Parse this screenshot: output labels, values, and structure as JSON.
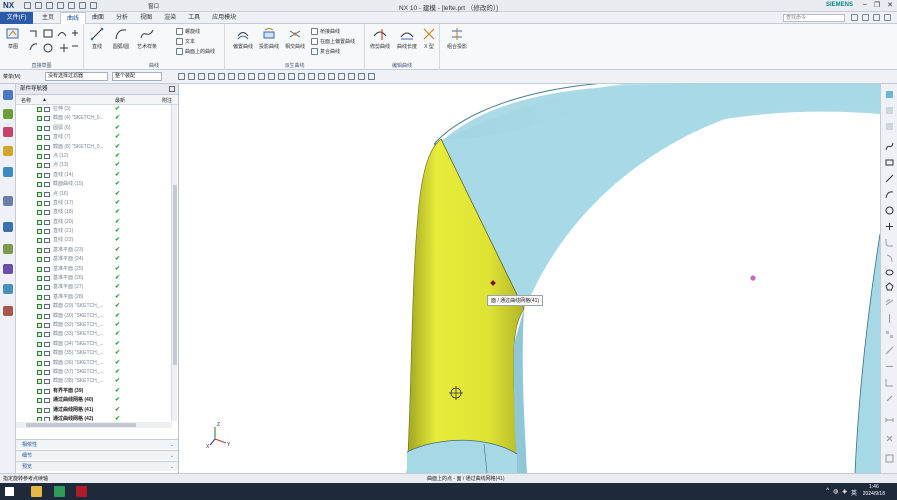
{
  "window": {
    "logo": "NX",
    "title": "NX 10 - 建模 - [lefte.prt （修改的）]",
    "brand": "SIEMENS",
    "window_menu": "窗口"
  },
  "menu": {
    "file": "文件(F)",
    "tabs": [
      "主页",
      "曲线",
      "曲面",
      "分析",
      "视图",
      "渲染",
      "工具",
      "应用模块"
    ],
    "active_tab": "曲线",
    "search_placeholder": "查找命令"
  },
  "ribbon": {
    "sketch": "草图",
    "direct_sketch_group": "直接草图",
    "line": "直线",
    "arc_circle": "圆弧/圆",
    "art_spline": "艺术样条",
    "small_curve": [
      "螺旋线",
      "文本",
      "曲面上的曲线"
    ],
    "curve_group": "曲线",
    "project_curve": "偏置曲线",
    "offset_curve": "投影曲线",
    "intersect_curve": "相交曲线",
    "derived_small": [
      "桥接曲线",
      "在面上偏置曲线",
      "复合曲线"
    ],
    "derived_group": "派生曲线",
    "trim_curve": "修剪曲线",
    "curve_length": "曲线长度",
    "x_type": "X 型",
    "combine_proj": "组合投影",
    "edit_group": "编辑曲线"
  },
  "selbar": {
    "menu": "菜单(M)",
    "filter": "没有选择过滤器",
    "assembly": "整个装配"
  },
  "navigator": {
    "title": "部件导航器",
    "col_name": "名称",
    "col_latest": "最新",
    "col_note": "附注",
    "rows": [
      {
        "label": "拉伸 (3)",
        "dark": false
      },
      {
        "label": "截面 (4) \"SKETCH_0...",
        "dark": false
      },
      {
        "label": "圆弧 (6)",
        "dark": false
      },
      {
        "label": "直线 (7)",
        "dark": false
      },
      {
        "label": "截面 (8) \"SKETCH_0...",
        "dark": false
      },
      {
        "label": "点 (12)",
        "dark": false
      },
      {
        "label": "点 (13)",
        "dark": false
      },
      {
        "label": "直线 (14)",
        "dark": false
      },
      {
        "label": "截面曲线 (15)",
        "dark": false
      },
      {
        "label": "点 (16)",
        "dark": false
      },
      {
        "label": "直线 (17)",
        "dark": false
      },
      {
        "label": "直线 (18)",
        "dark": false
      },
      {
        "label": "直线 (20)",
        "dark": false
      },
      {
        "label": "直线 (21)",
        "dark": false
      },
      {
        "label": "直线 (22)",
        "dark": false
      },
      {
        "label": "基准平面 (23)",
        "dark": false
      },
      {
        "label": "基准平面 (24)",
        "dark": false
      },
      {
        "label": "基准平面 (25)",
        "dark": false
      },
      {
        "label": "基准平面 (26)",
        "dark": false
      },
      {
        "label": "基准平面 (27)",
        "dark": false
      },
      {
        "label": "基准平面 (28)",
        "dark": false
      },
      {
        "label": "截面 (29) \"SKETCH_...",
        "dark": false
      },
      {
        "label": "截面 (30) \"SKETCH_...",
        "dark": false
      },
      {
        "label": "截面 (32) \"SKETCH_...",
        "dark": false
      },
      {
        "label": "截面 (33) \"SKETCH_...",
        "dark": false
      },
      {
        "label": "截面 (34) \"SKETCH_...",
        "dark": false
      },
      {
        "label": "截面 (35) \"SKETCH_...",
        "dark": false
      },
      {
        "label": "截面 (36) \"SKETCH_...",
        "dark": false
      },
      {
        "label": "截面 (37) \"SKETCH_...",
        "dark": false
      },
      {
        "label": "截面 (38) \"SKETCH_...",
        "dark": false
      },
      {
        "label": "有界平面 (39)",
        "dark": true
      },
      {
        "label": "通过曲线网格 (40)",
        "dark": true
      },
      {
        "label": "通过曲线网格 (41)",
        "dark": true
      },
      {
        "label": "通过曲线网格 (42)",
        "dark": true
      }
    ],
    "sections": [
      "相依性",
      "细节",
      "预览"
    ]
  },
  "graphics": {
    "tooltip": "面 / 通过曲线网格(41)"
  },
  "status": {
    "left": "指定旋转参考点续轴",
    "right": "曲面上的点 - 面 / 通过曲线网格(41)"
  },
  "taskbar": {
    "ime": "英",
    "time": "1:46",
    "date": "2024/9/18"
  },
  "colors": {
    "accent": "#2b5aa8",
    "body_blue": "#a6d8e6",
    "highlight_yellow": "#e8ec3a",
    "check_green": "#1ea02a"
  }
}
